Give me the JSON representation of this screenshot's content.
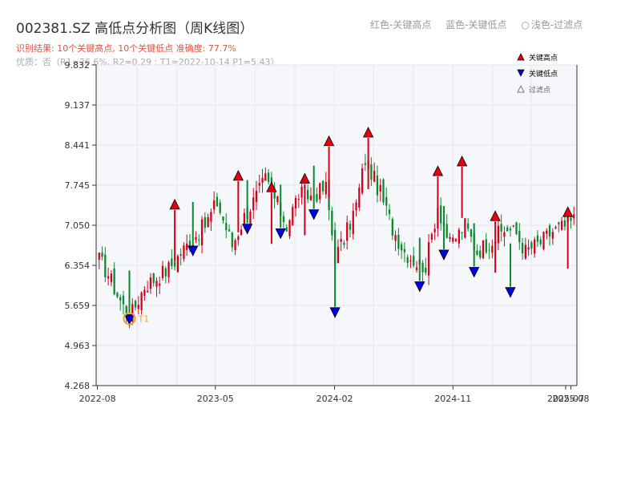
{
  "title": "002381.SZ 高低点分析图（周K线图）",
  "subtitle_result": "识别结果: 10个关键高点, 10个关键低点 准确度: 77.7%",
  "subtitle_quality": "优质：否（R1=26.6%, R2=0.29 ; T1=2022-10-14 P1=5.43）",
  "top_legend": {
    "red": "红色-关键高点",
    "blue": "蓝色-关键低点",
    "circle_icon": "○",
    "light": "浅色-过滤点"
  },
  "colors": {
    "up": "#d0021b",
    "down": "#0a8a2e",
    "high_marker": "#e8000b",
    "low_marker": "#0000e0",
    "t1": "#f0a030",
    "plot_bg": "#f5f7fa"
  },
  "chart_data": {
    "type": "candlestick",
    "ylim": [
      4.268,
      9.832
    ],
    "yticks": [
      4.268,
      4.963,
      5.659,
      6.354,
      7.05,
      7.745,
      8.441,
      9.137,
      9.832
    ],
    "ytick_labels": [
      "4.268",
      "4.963",
      "5.659",
      "6.354",
      "7.050",
      "7.745",
      "8.441",
      "9.137",
      "9.832"
    ],
    "xlim": [
      "2022-08",
      "2025-08"
    ],
    "xticks": [
      "2022-08",
      "2023-05",
      "2024-02",
      "2024-11",
      "2025-07",
      "2025-08"
    ],
    "legend": [
      {
        "marker": "triangle-up",
        "label": "关键高点",
        "color": "#e8000b"
      },
      {
        "marker": "triangle-down",
        "label": "关键低点",
        "color": "#0000e0"
      },
      {
        "marker": "triangle-up-hollow",
        "label": "过滤点",
        "color": "#555555"
      }
    ],
    "annotation": {
      "label": "T1",
      "date": "2022-10-14",
      "price": 5.43
    },
    "anchors": [
      [
        "2022-08-05",
        6.45
      ],
      [
        "2022-08-26",
        6.2
      ],
      [
        "2022-09-16",
        5.85
      ],
      [
        "2022-10-14",
        5.43
      ],
      [
        "2022-11-18",
        6.0
      ],
      [
        "2023-01-13",
        6.3
      ],
      [
        "2023-02-24",
        6.7
      ],
      [
        "2023-04-07",
        7.05
      ],
      [
        "2023-05-05",
        7.45
      ],
      [
        "2023-06-09",
        6.7
      ],
      [
        "2023-07-07",
        7.2
      ],
      [
        "2023-08-04",
        7.55
      ],
      [
        "2023-08-25",
        7.85
      ],
      [
        "2023-09-22",
        7.4
      ],
      [
        "2023-10-13",
        7.05
      ],
      [
        "2023-11-10",
        7.6
      ],
      [
        "2023-12-08",
        7.55
      ],
      [
        "2024-01-12",
        7.7
      ],
      [
        "2024-02-02",
        6.5
      ],
      [
        "2024-02-23",
        6.8
      ],
      [
        "2024-03-22",
        7.4
      ],
      [
        "2024-04-12",
        8.2
      ],
      [
        "2024-05-17",
        7.6
      ],
      [
        "2024-06-14",
        7.0
      ],
      [
        "2024-07-12",
        6.6
      ],
      [
        "2024-08-09",
        6.4
      ],
      [
        "2024-08-30",
        6.35
      ],
      [
        "2024-09-27",
        7.4
      ],
      [
        "2024-10-25",
        6.7
      ],
      [
        "2024-11-29",
        7.05
      ],
      [
        "2024-12-27",
        6.6
      ],
      [
        "2025-02-07",
        6.85
      ],
      [
        "2025-03-07",
        7.0
      ],
      [
        "2025-03-28",
        6.9
      ],
      [
        "2025-04-18",
        6.6
      ],
      [
        "2025-05-23",
        6.75
      ],
      [
        "2025-06-20",
        6.95
      ],
      [
        "2025-07-25",
        7.05
      ],
      [
        "2025-08-08",
        7.15
      ]
    ],
    "key_highs": [
      {
        "date": "2023-01-27",
        "price": 7.4
      },
      {
        "date": "2023-06-23",
        "price": 7.9
      },
      {
        "date": "2023-09-08",
        "price": 7.7
      },
      {
        "date": "2023-11-24",
        "price": 7.85
      },
      {
        "date": "2024-01-19",
        "price": 8.5
      },
      {
        "date": "2024-04-19",
        "price": 8.65
      },
      {
        "date": "2024-09-27",
        "price": 7.98
      },
      {
        "date": "2024-11-22",
        "price": 8.15
      },
      {
        "date": "2025-02-07",
        "price": 7.2
      },
      {
        "date": "2025-07-25",
        "price": 7.27
      }
    ],
    "key_lows": [
      {
        "date": "2022-10-14",
        "price": 5.43
      },
      {
        "date": "2023-03-10",
        "price": 6.62
      },
      {
        "date": "2023-07-14",
        "price": 7.0
      },
      {
        "date": "2023-09-29",
        "price": 6.92
      },
      {
        "date": "2023-12-15",
        "price": 7.25
      },
      {
        "date": "2024-02-02",
        "price": 5.55
      },
      {
        "date": "2024-08-16",
        "price": 6.0
      },
      {
        "date": "2024-10-11",
        "price": 6.55
      },
      {
        "date": "2024-12-20",
        "price": 6.25
      },
      {
        "date": "2025-03-14",
        "price": 5.9
      }
    ]
  }
}
